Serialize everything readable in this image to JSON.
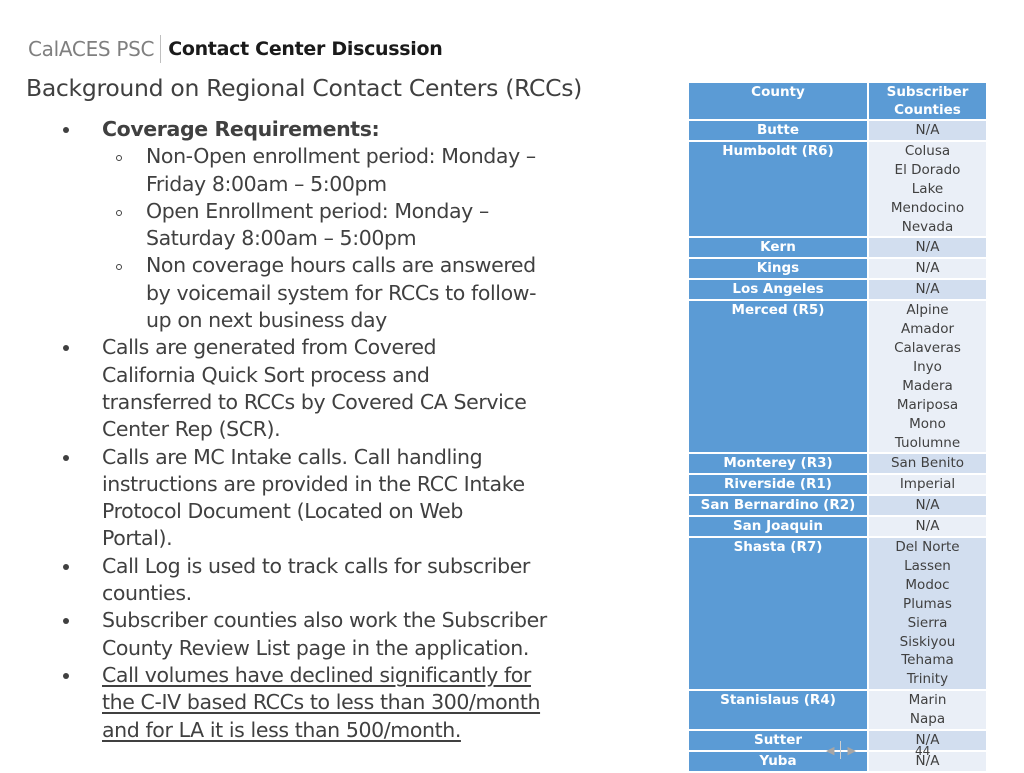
{
  "header": {
    "brand": "CalACES PSC",
    "title": "Contact Center Discussion"
  },
  "subtitle": "Background on Regional Contact Centers (RCCs)",
  "bullets": {
    "coverage_heading": "Coverage Requirements:",
    "sub": [
      [
        "Non-Open enrollment period: Monday –",
        "Friday 8:00am – 5:00pm"
      ],
      [
        "Open Enrollment period: Monday –",
        "Saturday 8:00am – 5:00pm"
      ],
      [
        "Non coverage hours calls are answered",
        "by voicemail system for RCCs to follow-",
        "up on next business day"
      ]
    ],
    "b2": [
      "Calls are generated from Covered",
      "California Quick Sort process and",
      "transferred to RCCs by Covered CA Service",
      "Center Rep (SCR)."
    ],
    "b3": [
      "Calls are MC Intake calls. Call handling",
      "instructions are provided in the RCC Intake",
      "Protocol Document (Located on Web",
      "Portal)."
    ],
    "b4": [
      "Call Log is used to track calls for subscriber",
      "counties."
    ],
    "b5": [
      "Subscriber counties also work the Subscriber",
      "County Review List page in the application."
    ],
    "b6": [
      "Call volumes have declined significantly for",
      "the C-IV based RCCs to less than 300/month",
      "and for LA it is less than 500/month."
    ]
  },
  "table": {
    "headers": {
      "county": "County",
      "subscriber": "Subscriber Counties"
    },
    "rows": [
      {
        "county": "Butte",
        "subscribers": "N/A"
      },
      {
        "county": "Humboldt (R6)",
        "subscribers": "Colusa\nEl Dorado\nLake\nMendocino\nNevada"
      },
      {
        "county": "Kern",
        "subscribers": "N/A"
      },
      {
        "county": "Kings",
        "subscribers": "N/A"
      },
      {
        "county": "Los Angeles",
        "subscribers": "N/A"
      },
      {
        "county": "Merced (R5)",
        "subscribers": "Alpine\nAmador\nCalaveras\nInyo\nMadera\nMariposa\nMono\nTuolumne"
      },
      {
        "county": "Monterey (R3)",
        "subscribers": "San Benito"
      },
      {
        "county": "Riverside (R1)",
        "subscribers": "Imperial"
      },
      {
        "county": "San Bernardino (R2)",
        "subscribers": "N/A"
      },
      {
        "county": "San Joaquin",
        "subscribers": "N/A"
      },
      {
        "county": "Shasta (R7)",
        "subscribers": "Del Norte\nLassen\nModoc\nPlumas\nSierra\nSiskiyou\nTehama\nTrinity"
      },
      {
        "county": "Stanislaus (R4)",
        "subscribers": "Marin\nNapa"
      },
      {
        "county": "Sutter",
        "subscribers": "N/A"
      },
      {
        "county": "Yuba",
        "subscribers": "N/A"
      }
    ]
  },
  "footer": {
    "prev_icon": "◀",
    "next_icon": "▶",
    "page_number": "44"
  }
}
